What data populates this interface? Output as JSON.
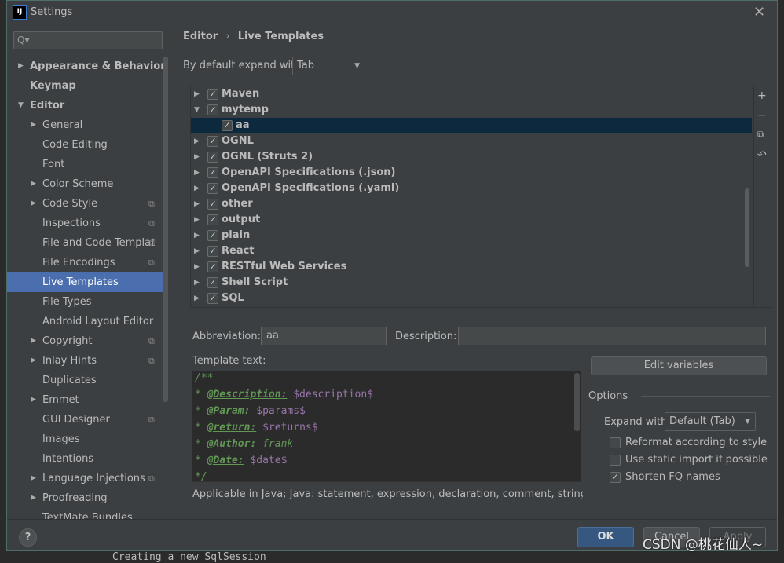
{
  "window": {
    "title": "Settings",
    "logo": "IJ",
    "close_icon": "close-icon"
  },
  "sidebar": {
    "search_placeholder": "Q▾",
    "items": [
      {
        "label": "Appearance & Behavior",
        "arrow": "▶",
        "bold": true,
        "indent": 0
      },
      {
        "label": "Keymap",
        "arrow": "",
        "bold": true,
        "indent": 0
      },
      {
        "label": "Editor",
        "arrow": "▼",
        "bold": true,
        "indent": 0
      },
      {
        "label": "General",
        "arrow": "▶",
        "indent": 1
      },
      {
        "label": "Code Editing",
        "arrow": "",
        "indent": 1
      },
      {
        "label": "Font",
        "arrow": "",
        "indent": 1
      },
      {
        "label": "Color Scheme",
        "arrow": "▶",
        "indent": 1
      },
      {
        "label": "Code Style",
        "arrow": "▶",
        "indent": 1,
        "copy": true
      },
      {
        "label": "Inspections",
        "arrow": "",
        "indent": 1,
        "copy": true
      },
      {
        "label": "File and Code Templat",
        "arrow": "",
        "indent": 1,
        "copy": true
      },
      {
        "label": "File Encodings",
        "arrow": "",
        "indent": 1,
        "copy": true
      },
      {
        "label": "Live Templates",
        "arrow": "",
        "indent": 1,
        "selected": true
      },
      {
        "label": "File Types",
        "arrow": "",
        "indent": 1
      },
      {
        "label": "Android Layout Editor",
        "arrow": "",
        "indent": 1
      },
      {
        "label": "Copyright",
        "arrow": "▶",
        "indent": 1,
        "copy": true
      },
      {
        "label": "Inlay Hints",
        "arrow": "▶",
        "indent": 1,
        "copy": true
      },
      {
        "label": "Duplicates",
        "arrow": "",
        "indent": 1
      },
      {
        "label": "Emmet",
        "arrow": "▶",
        "indent": 1
      },
      {
        "label": "GUI Designer",
        "arrow": "",
        "indent": 1,
        "copy": true
      },
      {
        "label": "Images",
        "arrow": "",
        "indent": 1
      },
      {
        "label": "Intentions",
        "arrow": "",
        "indent": 1
      },
      {
        "label": "Language Injections",
        "arrow": "▶",
        "indent": 1,
        "copy": true
      },
      {
        "label": "Proofreading",
        "arrow": "▶",
        "indent": 1
      },
      {
        "label": "TextMate Bundles",
        "arrow": "",
        "indent": 1
      }
    ]
  },
  "breadcrumb": {
    "parent": "Editor",
    "sep": "›",
    "current": "Live Templates"
  },
  "expand_default": {
    "label": "By default expand with",
    "value": "Tab"
  },
  "tree": {
    "rows": [
      {
        "label": "Maven",
        "arrow": "▶",
        "level": 0
      },
      {
        "label": "mytemp",
        "arrow": "▼",
        "level": 0
      },
      {
        "label": "aa",
        "arrow": "",
        "level": 1,
        "selected": true
      },
      {
        "label": "OGNL",
        "arrow": "▶",
        "level": 0
      },
      {
        "label": "OGNL (Struts 2)",
        "arrow": "▶",
        "level": 0
      },
      {
        "label": "OpenAPI Specifications (.json)",
        "arrow": "▶",
        "level": 0
      },
      {
        "label": "OpenAPI Specifications (.yaml)",
        "arrow": "▶",
        "level": 0
      },
      {
        "label": "other",
        "arrow": "▶",
        "level": 0
      },
      {
        "label": "output",
        "arrow": "▶",
        "level": 0
      },
      {
        "label": "plain",
        "arrow": "▶",
        "level": 0
      },
      {
        "label": "React",
        "arrow": "▶",
        "level": 0
      },
      {
        "label": "RESTful Web Services",
        "arrow": "▶",
        "level": 0
      },
      {
        "label": "Shell Script",
        "arrow": "▶",
        "level": 0
      },
      {
        "label": "SQL",
        "arrow": "▶",
        "level": 0
      }
    ],
    "tools": [
      "+",
      "−",
      "⧉",
      "↶"
    ]
  },
  "abbreviation": {
    "label": "Abbreviation:",
    "value": "aa"
  },
  "description": {
    "label": "Description:",
    "value": ""
  },
  "template_text": {
    "label": "Template text:",
    "lines": [
      {
        "prefix": "/**"
      },
      {
        "prefix": "* ",
        "tag": "@Description:",
        "rest": " ",
        "var": "$description$"
      },
      {
        "prefix": "* ",
        "tag": "@Param:",
        "rest": " ",
        "var": "$params$"
      },
      {
        "prefix": "* ",
        "tag": "@return:",
        "rest": " ",
        "var": "$returns$"
      },
      {
        "prefix": "* ",
        "tag": "@Author:",
        "rest": " frank",
        "var": ""
      },
      {
        "prefix": "* ",
        "tag": "@Date:",
        "rest": " ",
        "var": "$date$"
      },
      {
        "prefix": "*/"
      }
    ]
  },
  "applicable": "Applicable in Java; Java: statement, expression, declaration, comment, string, smart ty",
  "edit_variables": "Edit variables",
  "options": {
    "title": "Options",
    "expand_label": "Expand with",
    "expand_value": "Default (Tab)",
    "checks": [
      {
        "label": "Reformat according to style",
        "checked": false
      },
      {
        "label": "Use static import if possible",
        "checked": false
      },
      {
        "label": "Shorten FQ names",
        "checked": true
      }
    ]
  },
  "buttons": {
    "ok": "OK",
    "cancel": "Cancel",
    "apply": "Apply",
    "help": "?"
  },
  "watermark": "CSDN @桃花仙人~",
  "background_text": "Creating a new SqlSession",
  "colors": {
    "selection": "#4b6eaf",
    "tree_selection": "#0d293e",
    "comment": "#629755",
    "variable": "#9876aa",
    "ok_button": "#365880"
  }
}
